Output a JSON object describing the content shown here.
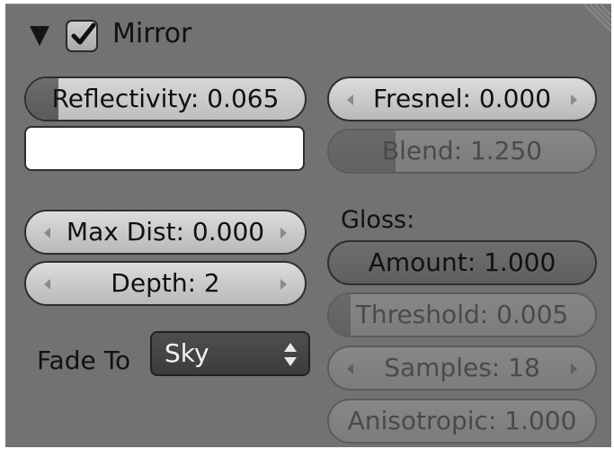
{
  "panel": {
    "title": "Mirror",
    "enabled": true
  },
  "left": {
    "reflectivity": {
      "label": "Reflectivity: 0.065",
      "fraction": 0.065
    },
    "color": "#ffffff",
    "max_dist": {
      "label": "Max Dist: 0.000"
    },
    "depth": {
      "label": "Depth: 2"
    },
    "fade_to": {
      "label": "Fade To",
      "value": "Sky"
    }
  },
  "right": {
    "fresnel": {
      "label": "Fresnel: 0.000"
    },
    "blend": {
      "label": "Blend: 1.250",
      "fraction": 0.25
    },
    "gloss_label": "Gloss:",
    "amount": {
      "label": "Amount: 1.000"
    },
    "threshold": {
      "label": "Threshold: 0.005",
      "fraction": 0.005
    },
    "samples": {
      "label": "Samples: 18"
    },
    "anisotropic": {
      "label": "Anisotropic: 1.000"
    }
  }
}
